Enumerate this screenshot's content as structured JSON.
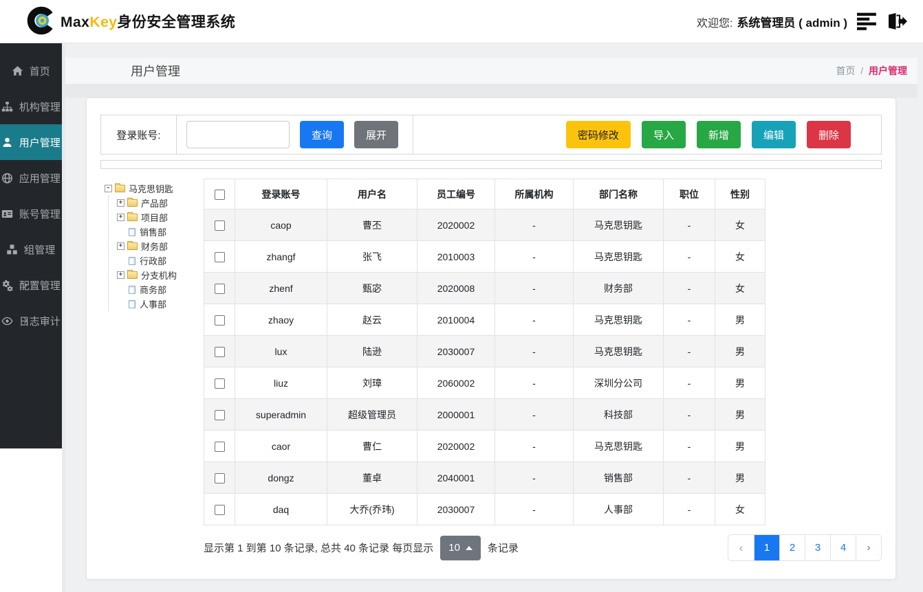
{
  "header": {
    "brand_max": "Max",
    "brand_key": "Key",
    "brand_suffix": "身份安全管理系统",
    "welcome_label": "欢迎您:",
    "user_name": "系统管理员 ( admin )",
    "icons": [
      "list-icon",
      "logout-icon"
    ]
  },
  "sidebar": {
    "items": [
      {
        "label": "首页",
        "icon": "home-icon",
        "active": false,
        "chevron": false
      },
      {
        "label": "机构管理",
        "icon": "sitemap-icon",
        "active": false,
        "chevron": false
      },
      {
        "label": "用户管理",
        "icon": "user-icon",
        "active": true,
        "chevron": false
      },
      {
        "label": "应用管理",
        "icon": "globe-icon",
        "active": false,
        "chevron": false
      },
      {
        "label": "账号管理",
        "icon": "idcard-icon",
        "active": false,
        "chevron": false
      },
      {
        "label": "组管理",
        "icon": "cubes-icon",
        "active": false,
        "chevron": true
      },
      {
        "label": "配置管理",
        "icon": "gears-icon",
        "active": false,
        "chevron": true
      },
      {
        "label": "日志审计",
        "icon": "eye-icon",
        "active": false,
        "chevron": true
      }
    ]
  },
  "breadcrumb": {
    "page_title": "用户管理",
    "home": "首页",
    "separator": "/",
    "current": "用户管理"
  },
  "toolbar": {
    "search_label": "登录账号:",
    "search_value": "",
    "query_label": "查询",
    "expand_label": "展开",
    "password_label": "密码修改",
    "import_label": "导入",
    "add_label": "新增",
    "edit_label": "编辑",
    "delete_label": "删除"
  },
  "tree": {
    "root": {
      "label": "马克思钥匙",
      "expander": "-",
      "icon": "open-folder-icon"
    },
    "children": [
      {
        "label": "产品部",
        "type": "folder",
        "expander": "+"
      },
      {
        "label": "项目部",
        "type": "folder",
        "expander": "+"
      },
      {
        "label": "销售部",
        "type": "file"
      },
      {
        "label": "财务部",
        "type": "folder",
        "expander": "+"
      },
      {
        "label": "行政部",
        "type": "file"
      },
      {
        "label": "分支机构",
        "type": "folder",
        "expander": "+"
      },
      {
        "label": "商务部",
        "type": "file"
      },
      {
        "label": "人事部",
        "type": "file"
      }
    ]
  },
  "table": {
    "columns": [
      "登录账号",
      "用户名",
      "员工编号",
      "所属机构",
      "部门名称",
      "职位",
      "性别"
    ],
    "rows": [
      [
        "caop",
        "曹丕",
        "2020002",
        "-",
        "马克思钥匙",
        "-",
        "女"
      ],
      [
        "zhangf",
        "张飞",
        "2010003",
        "-",
        "马克思钥匙",
        "-",
        "女"
      ],
      [
        "zhenf",
        "甄宓",
        "2020008",
        "-",
        "财务部",
        "-",
        "女"
      ],
      [
        "zhaoy",
        "赵云",
        "2010004",
        "-",
        "马克思钥匙",
        "-",
        "男"
      ],
      [
        "lux",
        "陆逊",
        "2030007",
        "-",
        "马克思钥匙",
        "-",
        "男"
      ],
      [
        "liuz",
        "刘璋",
        "2060002",
        "-",
        "深圳分公司",
        "-",
        "男"
      ],
      [
        "superadmin",
        "超级管理员",
        "2000001",
        "-",
        "科技部",
        "-",
        "男"
      ],
      [
        "caor",
        "曹仁",
        "2020002",
        "-",
        "马克思钥匙",
        "-",
        "男"
      ],
      [
        "dongz",
        "董卓",
        "2040001",
        "-",
        "销售部",
        "-",
        "男"
      ],
      [
        "daq",
        "大乔(乔玮)",
        "2030007",
        "-",
        "人事部",
        "-",
        "女"
      ]
    ]
  },
  "pagination": {
    "summary_before": "显示第 1 到第 10 条记录, 总共 40 条记录 每页显示",
    "page_size": "10",
    "summary_after": "条记录",
    "prev": "‹",
    "next": "›",
    "pages": [
      "1",
      "2",
      "3",
      "4"
    ],
    "active_page": "1"
  },
  "colors": {
    "accent_teal_active": "#1a7b8a",
    "primary_blue": "#1778f2",
    "warning_yellow": "#fcc30d",
    "success_green": "#28a745",
    "info_teal": "#17a2b8",
    "danger_red": "#dc3545",
    "breadcrumb_pink": "#dc2a6e",
    "brand_gold": "#f5bb0c",
    "sidebar_dark": "#23272b"
  }
}
